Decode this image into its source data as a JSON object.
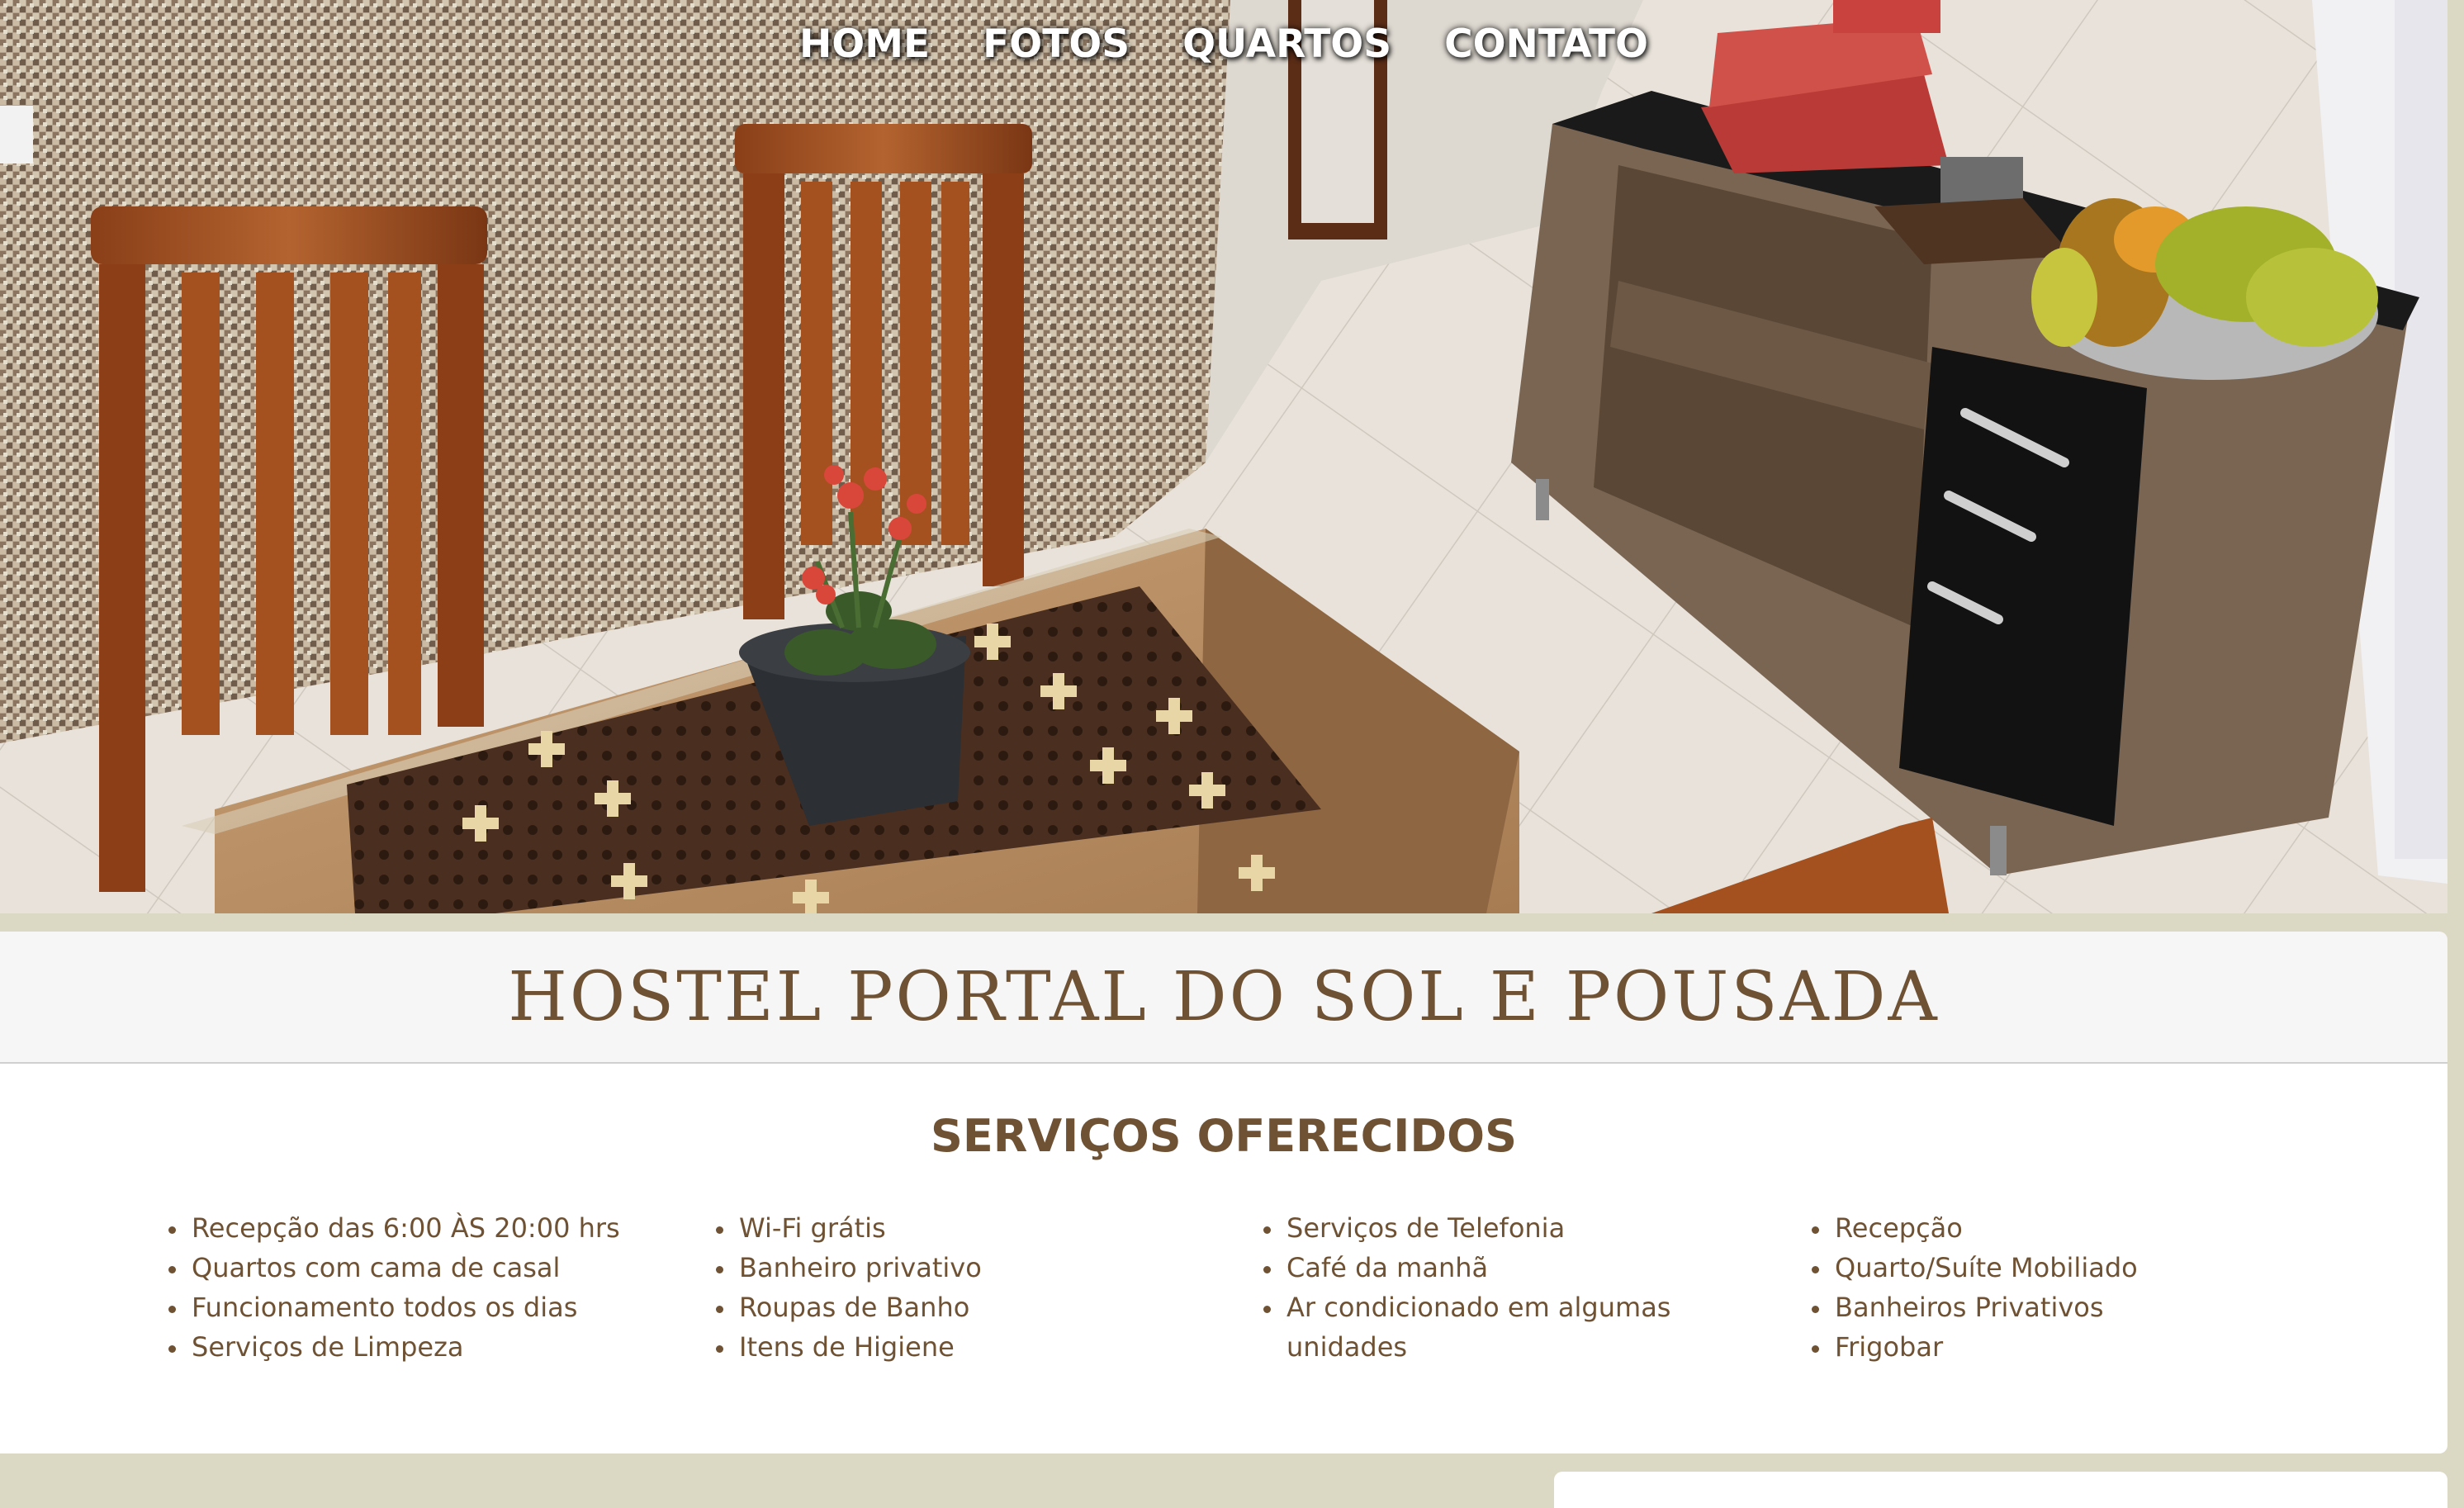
{
  "nav": {
    "items": [
      "HOME",
      "FOTOS",
      "QUARTOS",
      "CONTATO"
    ]
  },
  "hero": {
    "alt": "Hostel dining area with wooden chairs, table with flower pot, sideboard with fruit and books"
  },
  "header": {
    "title": "HOSTEL PORTAL DO SOL E POUSADA"
  },
  "services": {
    "heading": "SERVIÇOS OFERECIDOS",
    "columns": [
      [
        "Recepção das 6:00 ÀS 20:00 hrs",
        "Quartos com cama de casal",
        "Funcionamento todos os dias",
        "Serviços de Limpeza"
      ],
      [
        "Wi-Fi grátis",
        "Banheiro privativo",
        "Roupas de Banho",
        "Itens de Higiene"
      ],
      [
        "Serviços de Telefonia",
        "Café da manhã",
        "Ar condicionado em algumas unidades"
      ],
      [
        "Recepção",
        "Quarto/Suíte Mobiliado",
        "Banheiros Privativos",
        "Frigobar"
      ]
    ]
  },
  "colors": {
    "page_background": "#dbd8c3",
    "brand_brown": "#6f5234",
    "title_bar_background": "#f6f6f6",
    "card_background": "#ffffff"
  }
}
